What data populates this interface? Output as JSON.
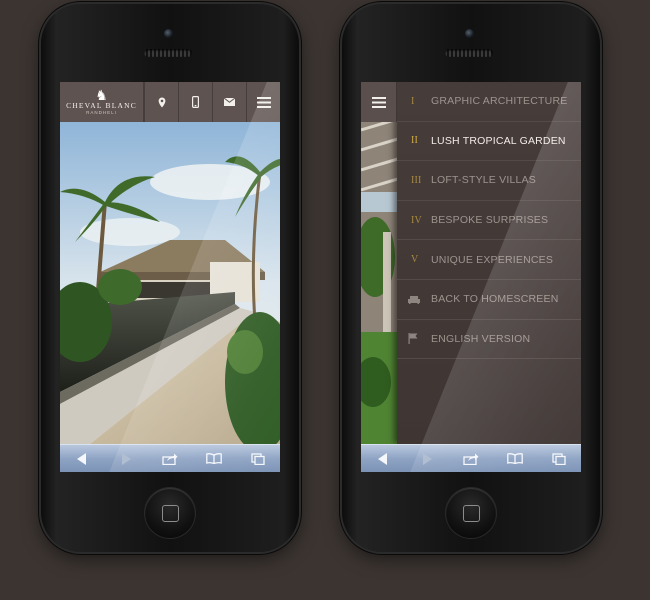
{
  "left_phone": {
    "logo": {
      "name": "CHEVAL BLANC",
      "sub": "RANDHELI"
    },
    "header_icons": [
      "location-pin-icon",
      "phone-icon",
      "mail-icon",
      "hamburger-menu-icon"
    ]
  },
  "right_phone": {
    "menu": {
      "items": [
        {
          "num": "I",
          "label": "GRAPHIC ARCHITECTURE",
          "active": false
        },
        {
          "num": "II",
          "label": "LUSH TROPICAL GARDEN",
          "active": true
        },
        {
          "num": "III",
          "label": "LOFT-STYLE VILLAS",
          "active": false
        },
        {
          "num": "IV",
          "label": "BESPOKE SURPRISES",
          "active": false
        },
        {
          "num": "V",
          "label": "UNIQUE EXPERIENCES",
          "active": false
        }
      ],
      "utility": [
        {
          "icon": "sofa-icon",
          "label": "BACK TO HOMESCREEN"
        },
        {
          "icon": "flag-icon",
          "label": "ENGLISH VERSION"
        }
      ]
    }
  },
  "toolbar_icons": [
    "back-arrow-icon",
    "forward-arrow-icon",
    "share-icon",
    "bookmarks-icon",
    "tabs-icon"
  ],
  "colors": {
    "background": "#3b3431",
    "header": "#5e5350",
    "menu_panel": "#433a38",
    "accent_gold": "#d4ad44",
    "toolbar": "#8fa4c4"
  }
}
